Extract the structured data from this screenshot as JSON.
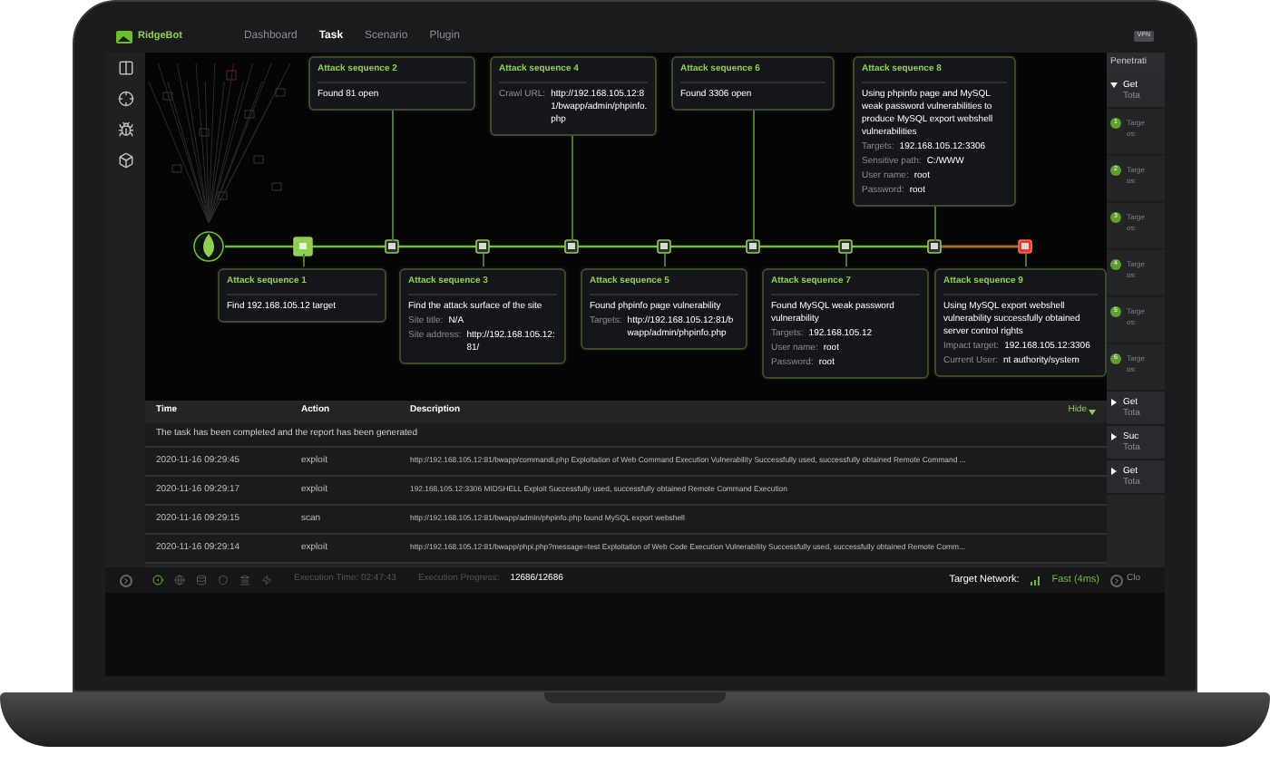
{
  "nav": {
    "logo": "RidgeBot",
    "items": [
      {
        "label": "Dashboard",
        "selected": false
      },
      {
        "label": "Task",
        "selected": true
      },
      {
        "label": "Scenario",
        "selected": false
      },
      {
        "label": "Plugin",
        "selected": false
      }
    ],
    "badge": "VPN"
  },
  "sequences": [
    {
      "title": "Attack sequence 1",
      "lines": [
        {
          "text": "Find 192.168.105.12 target"
        }
      ]
    },
    {
      "title": "Attack sequence 2",
      "lines": [
        {
          "text": "Found 81 open"
        }
      ]
    },
    {
      "title": "Attack sequence 3",
      "lines": [
        {
          "text": "Find the attack surface of the site"
        },
        {
          "label": "Site title:",
          "value": "N/A"
        },
        {
          "label": "Site address:",
          "value": "http://192.168.105.12:81/"
        }
      ]
    },
    {
      "title": "Attack sequence 4",
      "lines": [
        {
          "label": "Crawl URL:",
          "value": "http://192.168.105.12:81/bwapp/admin/phpinfo.php"
        }
      ]
    },
    {
      "title": "Attack sequence 5",
      "lines": [
        {
          "text": "Found phpinfo page vulnerability"
        },
        {
          "label": "Targets:",
          "value": "http://192.168.105.12:81/bwapp/admin/phpinfo.php"
        }
      ]
    },
    {
      "title": "Attack sequence 6",
      "lines": [
        {
          "text": "Found 3306 open"
        }
      ]
    },
    {
      "title": "Attack sequence 7",
      "lines": [
        {
          "text": "Found MySQL weak password vulnerability"
        },
        {
          "label": "Targets:",
          "value": "192.168.105.12"
        },
        {
          "label": "User name:",
          "value": "root"
        },
        {
          "label": "Password:",
          "value": "root"
        }
      ]
    },
    {
      "title": "Attack sequence 8",
      "lines": [
        {
          "text": "Using phpinfo page and MySQL weak password vulnerabilities to produce MySQL export webshell vulnerabilities"
        },
        {
          "label": "Targets:",
          "value": "192.168.105.12:3306"
        },
        {
          "label": "Sensitive path:",
          "value": "C:/WWW"
        },
        {
          "label": "User name:",
          "value": "root"
        },
        {
          "label": "Password:",
          "value": "root"
        }
      ]
    },
    {
      "title": "Attack sequence 9",
      "lines": [
        {
          "text": "Using MySQL export webshell vulnerability successfully obtained server control rights"
        },
        {
          "label": "Impact target:",
          "value": "192.168.105.12:3306"
        },
        {
          "label": "Current User:",
          "value": "nt authority/system"
        }
      ]
    }
  ],
  "timeline": {
    "nodes": [
      {
        "kind": "current"
      },
      {
        "kind": "step"
      },
      {
        "kind": "step"
      },
      {
        "kind": "step"
      },
      {
        "kind": "step"
      },
      {
        "kind": "step"
      },
      {
        "kind": "step"
      },
      {
        "kind": "step"
      },
      {
        "kind": "alert"
      }
    ]
  },
  "log": {
    "columns": [
      "Time",
      "Action",
      "Description"
    ],
    "hide": "Hide",
    "message": "The task has been completed and the report has been generated",
    "rows": [
      [
        "2020-11-16 09:29:45",
        "exploit",
        "http://192.168.105.12:81/bwapp/commandi.php Exploitation of Web Command Execution Vulnerability Successfully used, successfully obtained Remote Command ..."
      ],
      [
        "2020-11-16 09:29:17",
        "exploit",
        "192.168.105.12:3306 MIDSHELL Exploit Successfully used, successfully obtained Remote Command Execution"
      ],
      [
        "2020-11-16 09:29:15",
        "scan",
        "http://192.168.105.12:81/bwapp/admin/phpinfo.php found MySQL export webshell"
      ],
      [
        "2020-11-16 09:29:14",
        "exploit",
        "http://192.168.105.12:81/bwapp/phpi.php?message=test Exploitation of Web Code Execution Vulnerability Successfully used, successfully obtained Remote Comm..."
      ]
    ]
  },
  "status_bar": {
    "time": "Execution Time: 02:47:43",
    "progress_label": "Execution Progress:",
    "progress": "12686/12686",
    "network_label": "Target Network:",
    "network": "Fast (4ms)",
    "close": "Clo"
  },
  "panel": {
    "title": "Penetrati",
    "groups": [
      {
        "expanded": true,
        "title": "Get",
        "sub": "Tota",
        "steps": [
          {
            "num": "1",
            "label": "Targe",
            "sub": "os:"
          },
          {
            "num": "2",
            "label": "Targe",
            "sub": "os:"
          },
          {
            "num": "3",
            "label": "Targe",
            "sub": "os:"
          },
          {
            "num": "4",
            "label": "Targe",
            "sub": "os:"
          },
          {
            "num": "5",
            "label": "Targe",
            "sub": "os:"
          },
          {
            "num": "6",
            "label": "Targe",
            "sub": "os:"
          }
        ]
      },
      {
        "expanded": false,
        "title": "Get",
        "sub": "Tota"
      },
      {
        "expanded": false,
        "title": "Suc",
        "sub": "Tota"
      },
      {
        "expanded": false,
        "title": "Get",
        "sub": "Tota"
      }
    ]
  }
}
